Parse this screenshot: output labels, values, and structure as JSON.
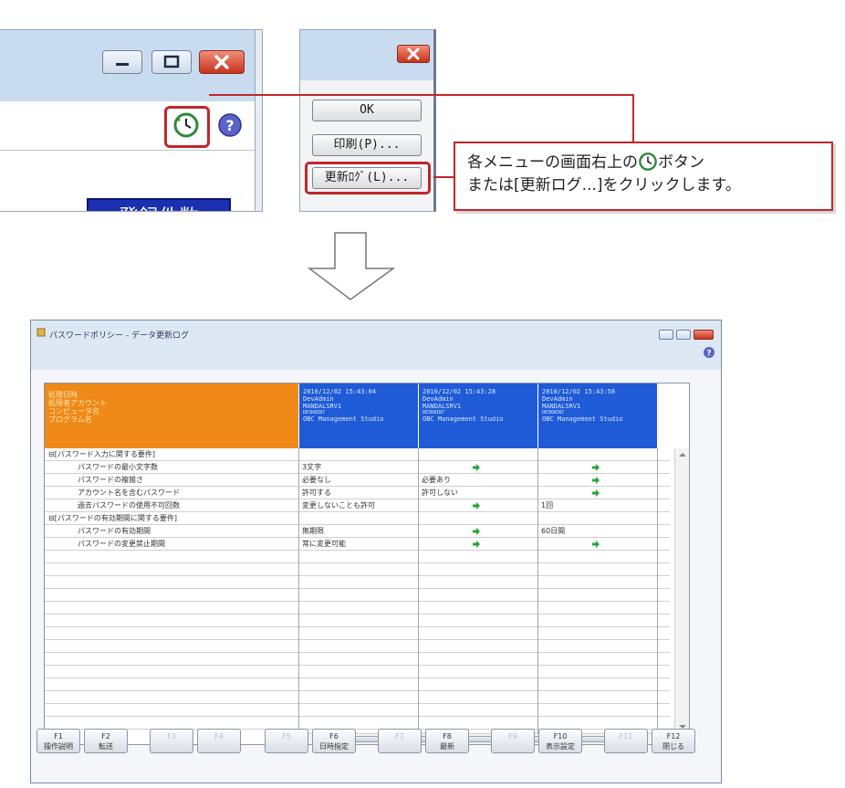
{
  "top_main_window": {
    "count_badge": "登録件数"
  },
  "dialog": {
    "ok_label": "OK",
    "print_label": "印刷(P)...",
    "update_log_label": "更新ﾛｸﾞ(L)..."
  },
  "callout": {
    "line1_before": "各メニューの画面右上の",
    "line1_after": "ボタン",
    "line2": "または[更新ログ...]をクリックします。"
  },
  "log_window": {
    "title": "パスワードポリシー - データ更新ログ",
    "header_labels": [
      "処理日時",
      "処理者アカウント",
      "コンピュータ名",
      "プログラム名"
    ],
    "columns": [
      {
        "datetime": "2010/12/02 15:43:04",
        "account": "DevAdmin",
        "server": "MANDALSRV1",
        "computer": "DESKWIN7",
        "program": "OBC Management Studio"
      },
      {
        "datetime": "2010/12/02 15:43:28",
        "account": "DevAdmin",
        "server": "MANDALSRV1",
        "computer": "DESKWIN7",
        "program": "OBC Management Studio"
      },
      {
        "datetime": "2010/12/02 15:43:58",
        "account": "DevAdmin",
        "server": "MANDALSRV1",
        "computer": "DESKWIN7",
        "program": "OBC Management Studio"
      }
    ],
    "rows": [
      {
        "label": "⊟[パスワード入力に関する要件]",
        "group": true,
        "v1": "",
        "v2": "",
        "v3": ""
      },
      {
        "label": "パスワードの最小文字数",
        "group": false,
        "v1": "3文字",
        "v2": "arrow",
        "v3": "arrow"
      },
      {
        "label": "パスワードの複雑さ",
        "group": false,
        "v1": "必要なし",
        "v2": "必要あり",
        "v3": "arrow"
      },
      {
        "label": "アカウント名を含むパスワード",
        "group": false,
        "v1": "許可する",
        "v2": "許可しない",
        "v3": "arrow"
      },
      {
        "label": "過去パスワードの使用不可回数",
        "group": false,
        "v1": "変更しないことも許可",
        "v2": "arrow",
        "v3": "1回"
      },
      {
        "label": "⊟[パスワードの有効期間に関する要件]",
        "group": true,
        "v1": "",
        "v2": "",
        "v3": ""
      },
      {
        "label": "パスワードの有効期間",
        "group": false,
        "v1": "無期限",
        "v2": "arrow",
        "v3": "60日間"
      },
      {
        "label": "パスワードの変更禁止期間",
        "group": false,
        "v1": "常に変更可能",
        "v2": "arrow",
        "v3": "arrow"
      }
    ],
    "function_keys": [
      {
        "key": "F1",
        "label": "操作説明",
        "enabled": true
      },
      {
        "key": "F2",
        "label": "転送",
        "enabled": true
      },
      {
        "key": "F3",
        "label": "",
        "enabled": false
      },
      {
        "key": "F4",
        "label": "",
        "enabled": false
      },
      {
        "key": "F5",
        "label": "",
        "enabled": false
      },
      {
        "key": "F6",
        "label": "日時指定",
        "enabled": true
      },
      {
        "key": "F7",
        "label": "",
        "enabled": false
      },
      {
        "key": "F8",
        "label": "最新",
        "enabled": true
      },
      {
        "key": "F9",
        "label": "",
        "enabled": false
      },
      {
        "key": "F10",
        "label": "表示設定",
        "enabled": true
      },
      {
        "key": "F11",
        "label": "",
        "enabled": false
      },
      {
        "key": "F12",
        "label": "閉じる",
        "enabled": true
      }
    ]
  },
  "colors": {
    "highlight_red": "#c0272d",
    "header_orange": "#ef8a18",
    "header_blue": "#1f5bd7",
    "badge_blue": "#1c2fae",
    "arrow_green": "#27a53a"
  },
  "icons": [
    "minimize-icon",
    "maximize-icon",
    "close-icon",
    "update-log-clock-icon",
    "help-icon",
    "down-arrow-icon",
    "right-arrow-icon"
  ]
}
